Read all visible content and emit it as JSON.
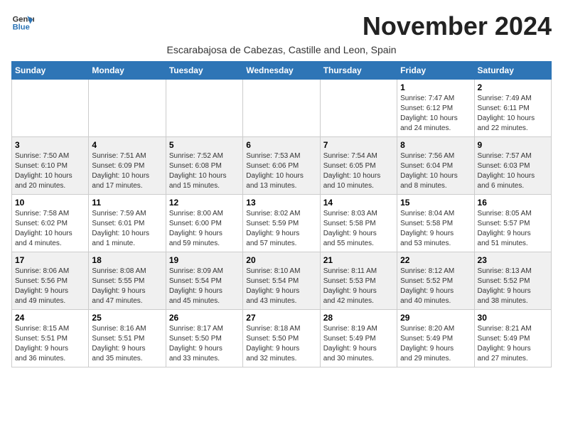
{
  "logo": {
    "line1": "General",
    "line2": "Blue"
  },
  "title": "November 2024",
  "subtitle": "Escarabajosa de Cabezas, Castille and Leon, Spain",
  "weekdays": [
    "Sunday",
    "Monday",
    "Tuesday",
    "Wednesday",
    "Thursday",
    "Friday",
    "Saturday"
  ],
  "weeks": [
    [
      {
        "day": "",
        "info": ""
      },
      {
        "day": "",
        "info": ""
      },
      {
        "day": "",
        "info": ""
      },
      {
        "day": "",
        "info": ""
      },
      {
        "day": "",
        "info": ""
      },
      {
        "day": "1",
        "info": "Sunrise: 7:47 AM\nSunset: 6:12 PM\nDaylight: 10 hours\nand 24 minutes."
      },
      {
        "day": "2",
        "info": "Sunrise: 7:49 AM\nSunset: 6:11 PM\nDaylight: 10 hours\nand 22 minutes."
      }
    ],
    [
      {
        "day": "3",
        "info": "Sunrise: 7:50 AM\nSunset: 6:10 PM\nDaylight: 10 hours\nand 20 minutes."
      },
      {
        "day": "4",
        "info": "Sunrise: 7:51 AM\nSunset: 6:09 PM\nDaylight: 10 hours\nand 17 minutes."
      },
      {
        "day": "5",
        "info": "Sunrise: 7:52 AM\nSunset: 6:08 PM\nDaylight: 10 hours\nand 15 minutes."
      },
      {
        "day": "6",
        "info": "Sunrise: 7:53 AM\nSunset: 6:06 PM\nDaylight: 10 hours\nand 13 minutes."
      },
      {
        "day": "7",
        "info": "Sunrise: 7:54 AM\nSunset: 6:05 PM\nDaylight: 10 hours\nand 10 minutes."
      },
      {
        "day": "8",
        "info": "Sunrise: 7:56 AM\nSunset: 6:04 PM\nDaylight: 10 hours\nand 8 minutes."
      },
      {
        "day": "9",
        "info": "Sunrise: 7:57 AM\nSunset: 6:03 PM\nDaylight: 10 hours\nand 6 minutes."
      }
    ],
    [
      {
        "day": "10",
        "info": "Sunrise: 7:58 AM\nSunset: 6:02 PM\nDaylight: 10 hours\nand 4 minutes."
      },
      {
        "day": "11",
        "info": "Sunrise: 7:59 AM\nSunset: 6:01 PM\nDaylight: 10 hours\nand 1 minute."
      },
      {
        "day": "12",
        "info": "Sunrise: 8:00 AM\nSunset: 6:00 PM\nDaylight: 9 hours\nand 59 minutes."
      },
      {
        "day": "13",
        "info": "Sunrise: 8:02 AM\nSunset: 5:59 PM\nDaylight: 9 hours\nand 57 minutes."
      },
      {
        "day": "14",
        "info": "Sunrise: 8:03 AM\nSunset: 5:58 PM\nDaylight: 9 hours\nand 55 minutes."
      },
      {
        "day": "15",
        "info": "Sunrise: 8:04 AM\nSunset: 5:58 PM\nDaylight: 9 hours\nand 53 minutes."
      },
      {
        "day": "16",
        "info": "Sunrise: 8:05 AM\nSunset: 5:57 PM\nDaylight: 9 hours\nand 51 minutes."
      }
    ],
    [
      {
        "day": "17",
        "info": "Sunrise: 8:06 AM\nSunset: 5:56 PM\nDaylight: 9 hours\nand 49 minutes."
      },
      {
        "day": "18",
        "info": "Sunrise: 8:08 AM\nSunset: 5:55 PM\nDaylight: 9 hours\nand 47 minutes."
      },
      {
        "day": "19",
        "info": "Sunrise: 8:09 AM\nSunset: 5:54 PM\nDaylight: 9 hours\nand 45 minutes."
      },
      {
        "day": "20",
        "info": "Sunrise: 8:10 AM\nSunset: 5:54 PM\nDaylight: 9 hours\nand 43 minutes."
      },
      {
        "day": "21",
        "info": "Sunrise: 8:11 AM\nSunset: 5:53 PM\nDaylight: 9 hours\nand 42 minutes."
      },
      {
        "day": "22",
        "info": "Sunrise: 8:12 AM\nSunset: 5:52 PM\nDaylight: 9 hours\nand 40 minutes."
      },
      {
        "day": "23",
        "info": "Sunrise: 8:13 AM\nSunset: 5:52 PM\nDaylight: 9 hours\nand 38 minutes."
      }
    ],
    [
      {
        "day": "24",
        "info": "Sunrise: 8:15 AM\nSunset: 5:51 PM\nDaylight: 9 hours\nand 36 minutes."
      },
      {
        "day": "25",
        "info": "Sunrise: 8:16 AM\nSunset: 5:51 PM\nDaylight: 9 hours\nand 35 minutes."
      },
      {
        "day": "26",
        "info": "Sunrise: 8:17 AM\nSunset: 5:50 PM\nDaylight: 9 hours\nand 33 minutes."
      },
      {
        "day": "27",
        "info": "Sunrise: 8:18 AM\nSunset: 5:50 PM\nDaylight: 9 hours\nand 32 minutes."
      },
      {
        "day": "28",
        "info": "Sunrise: 8:19 AM\nSunset: 5:49 PM\nDaylight: 9 hours\nand 30 minutes."
      },
      {
        "day": "29",
        "info": "Sunrise: 8:20 AM\nSunset: 5:49 PM\nDaylight: 9 hours\nand 29 minutes."
      },
      {
        "day": "30",
        "info": "Sunrise: 8:21 AM\nSunset: 5:49 PM\nDaylight: 9 hours\nand 27 minutes."
      }
    ]
  ]
}
